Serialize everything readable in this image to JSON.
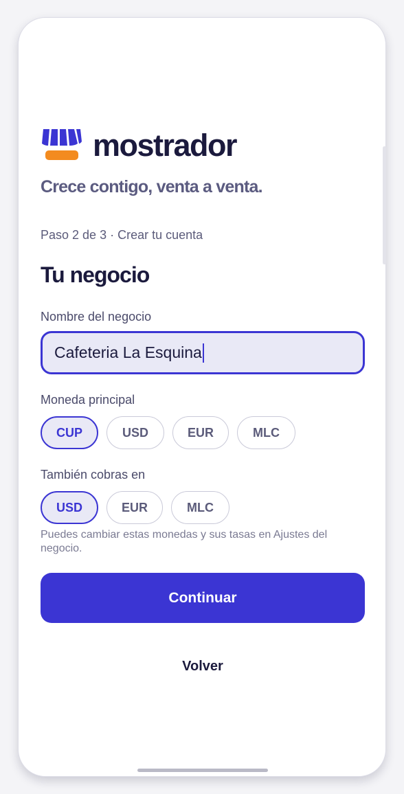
{
  "brand": {
    "name": "mostrador",
    "tagline": "Crece contigo, venta a venta.",
    "logo_icon": "storefront-awning-icon",
    "colors": {
      "primary": "#3b35d3",
      "accent": "#f38b1f",
      "text": "#1b1a3d"
    }
  },
  "step": "Paso 2 de 3 · Crear tu cuenta",
  "section_title": "Tu negocio",
  "business_name": {
    "label": "Nombre del negocio",
    "value": "Cafeteria La Esquina"
  },
  "main_currency": {
    "label": "Moneda principal",
    "options": [
      "CUP",
      "USD",
      "EUR",
      "MLC"
    ],
    "selected": "CUP"
  },
  "also_accept": {
    "label": "También cobras en",
    "options": [
      "USD",
      "EUR",
      "MLC"
    ],
    "selected": [
      "USD"
    ]
  },
  "hint": "Puedes cambiar estas monedas y sus tasas en Ajustes del negocio.",
  "actions": {
    "continue_label": "Continuar",
    "back_label": "Volver"
  }
}
